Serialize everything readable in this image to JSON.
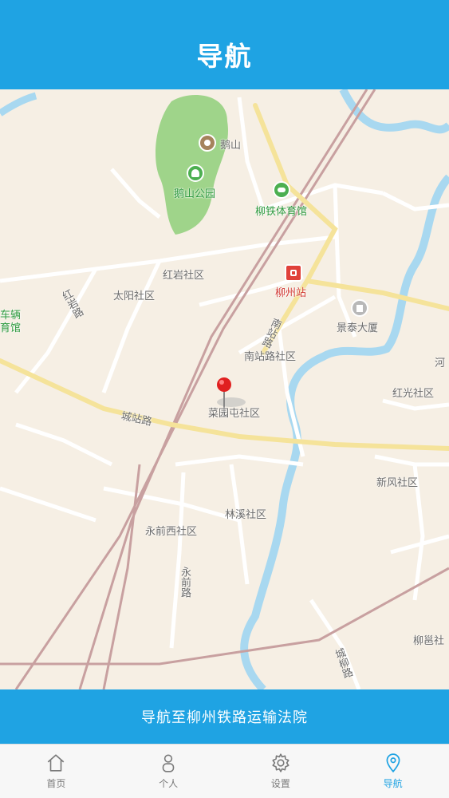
{
  "header": {
    "title": "导航"
  },
  "map": {
    "labels": {
      "eshan": "鹅山",
      "eshan_park": "鹅山公园",
      "liutie_gym": "柳铁体育馆",
      "hongyan_community": "红岩社区",
      "taiyang_community": "太阳社区",
      "hongyan_road": "红岩路",
      "chexiang_gym_1": "车辆",
      "chexiang_gym_2": "育馆",
      "liuzhou_station": "柳州站",
      "nanzhan_road": "南站路",
      "jingtai_building": "景泰大厦",
      "nanzhan_community": "南站路社区",
      "he": "河",
      "hongguang_community": "红光社区",
      "caiyuantun_community": "菜园屯社区",
      "chengzhan_road": "城站路",
      "xinfeng_community": "新风社区",
      "linxi_community": "林溪社区",
      "yongnanxi_community": "永前西社区",
      "yongqian_road": "永前路",
      "chengliu_road": "城柳路",
      "liushan_community": "柳邕社"
    }
  },
  "navigate_button": {
    "label": "导航至柳州铁路运输法院"
  },
  "tabs": [
    {
      "label": "首页",
      "icon": "home-icon",
      "active": false
    },
    {
      "label": "个人",
      "icon": "person-icon",
      "active": false
    },
    {
      "label": "设置",
      "icon": "gear-icon",
      "active": false
    },
    {
      "label": "导航",
      "icon": "location-pin-icon",
      "active": true
    }
  ],
  "colors": {
    "accent": "#1fa3e3",
    "park": "#9fd48a",
    "water": "#a8d8f0",
    "road_major": "#f5e39a",
    "railway": "#c8a0a0"
  }
}
